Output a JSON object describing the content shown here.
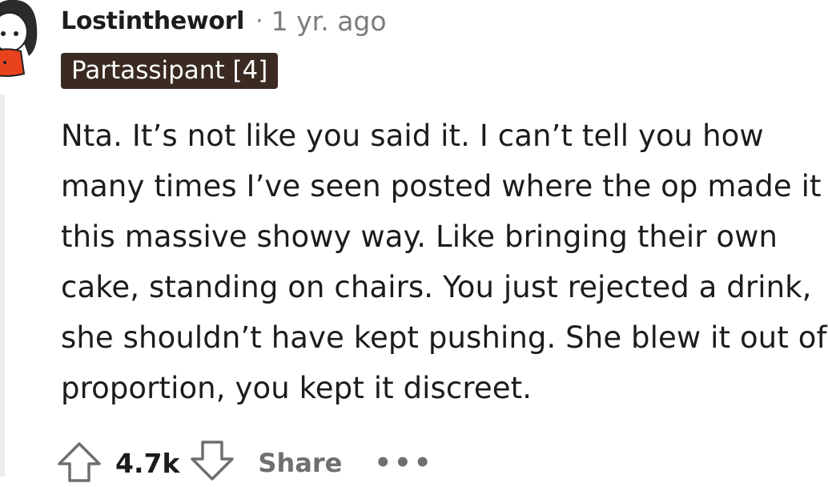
{
  "comment": {
    "author": "Lostintheworl",
    "separator": "·",
    "timestamp": "1 yr. ago",
    "flair": "Partassipant [4]",
    "body": "Nta. It’s not like you said it. I can’t tell you how many times I’ve seen posted where the op made it this massive showy way. Like bringing their own cake, standing on chairs. You just rejected a drink, she shouldn’t have kept pushing. She blew it out of proportion, you kept it discreet."
  },
  "actions": {
    "score": "4.7k",
    "share_label": "Share",
    "more_label": "•••"
  },
  "colors": {
    "flair_bg": "#3a2a21",
    "text": "#1c1c1c",
    "muted": "#7c7c7c",
    "avatar_sweater": "#e8431c"
  },
  "icons": {
    "avatar": "snoo-avatar-icon",
    "upvote": "upvote-arrow-icon",
    "downvote": "downvote-arrow-icon",
    "more": "more-options-icon"
  }
}
